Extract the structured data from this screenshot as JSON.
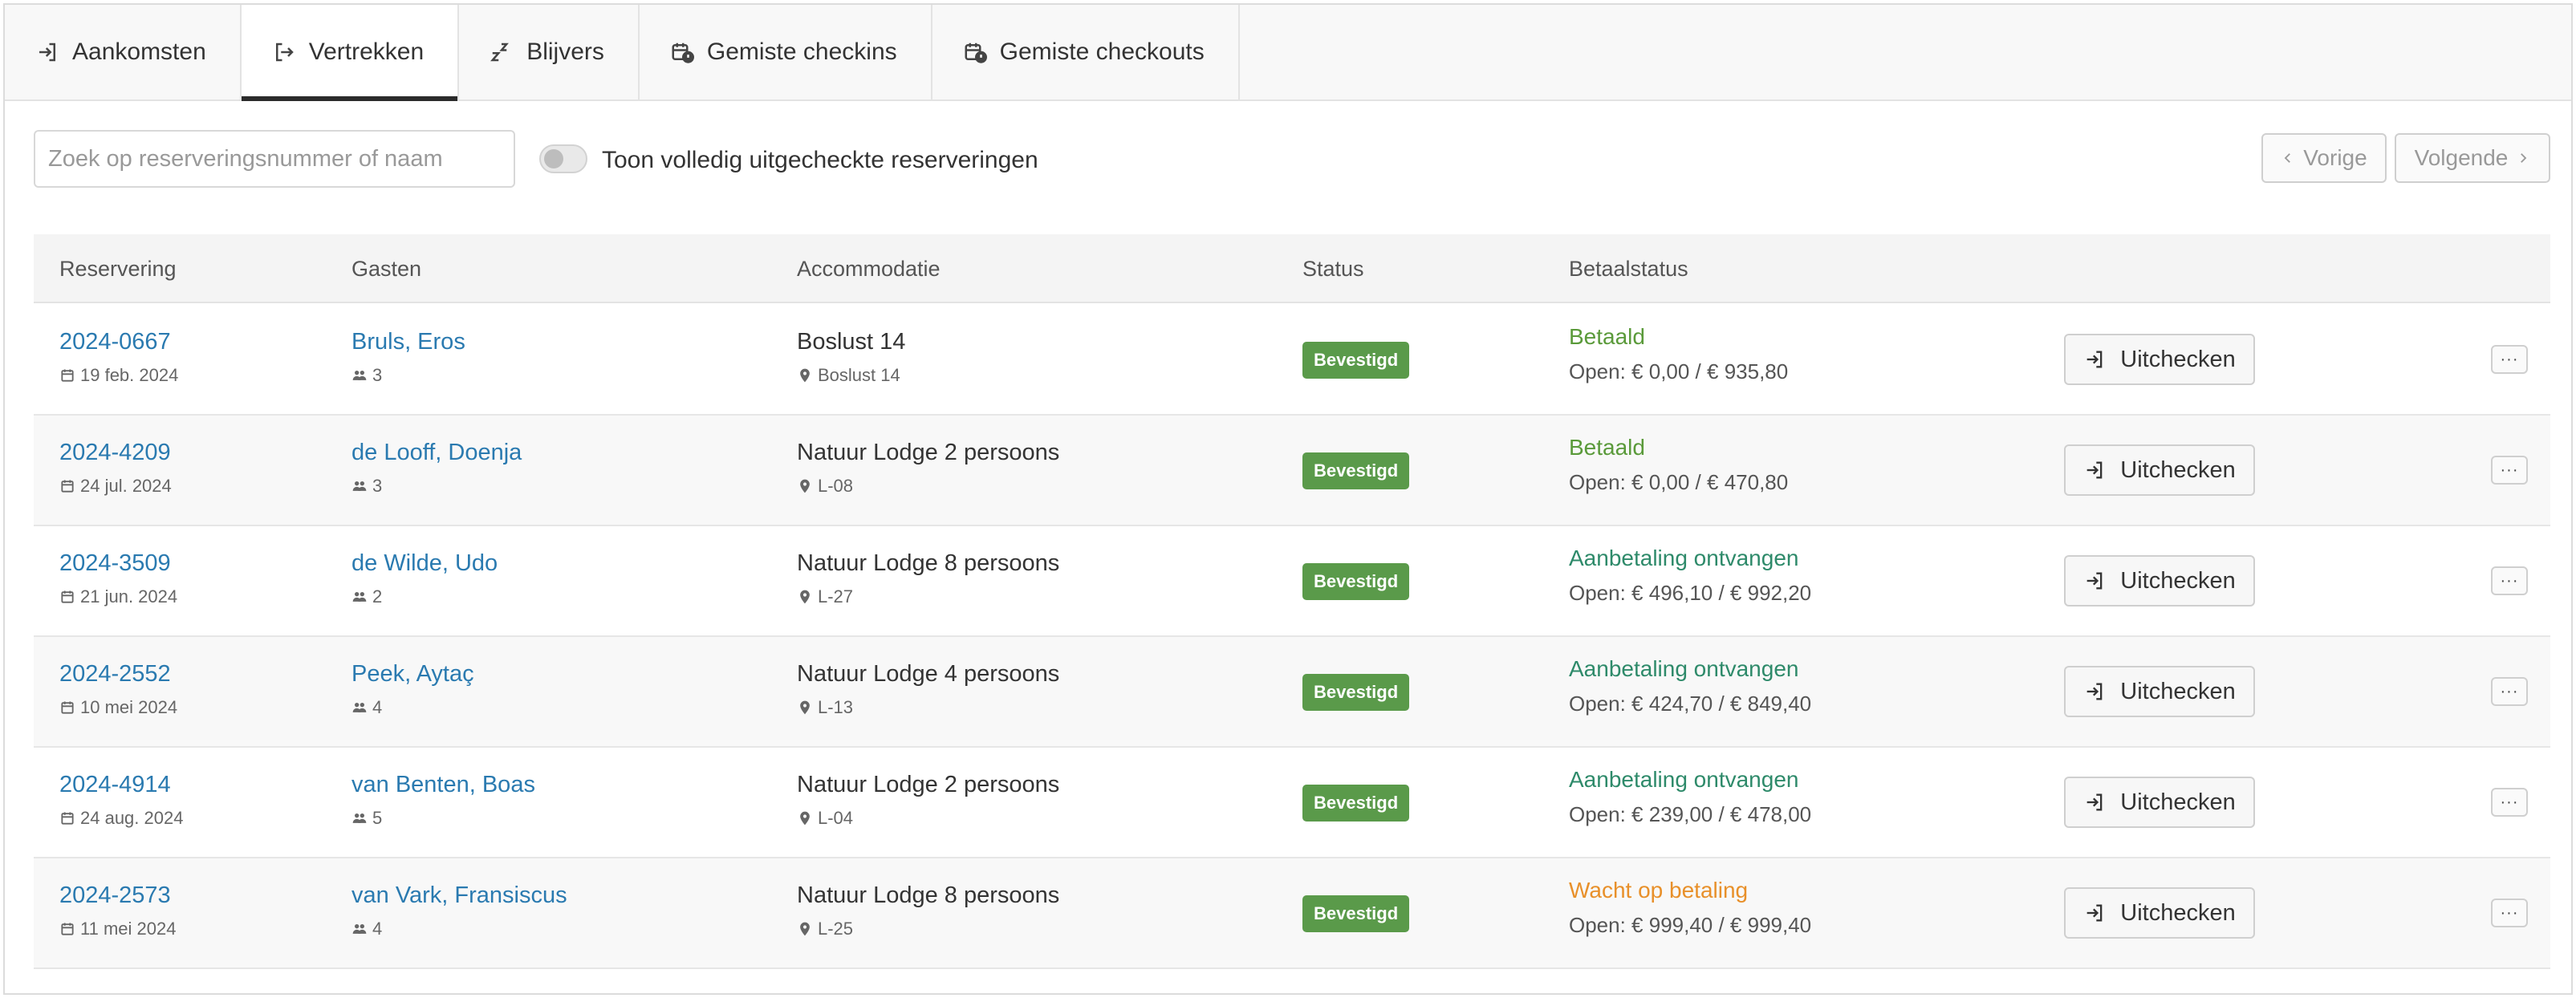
{
  "tabs": [
    {
      "label": "Aankomsten",
      "icon": "sign-in-icon",
      "active": false
    },
    {
      "label": "Vertrekken",
      "icon": "sign-out-icon",
      "active": true
    },
    {
      "label": "Blijvers",
      "icon": "sleep-zzz-icon",
      "active": false
    },
    {
      "label": "Gemiste checkins",
      "icon": "calendar-alert-icon",
      "active": false
    },
    {
      "label": "Gemiste checkouts",
      "icon": "calendar-alert-icon",
      "active": false
    }
  ],
  "search": {
    "placeholder": "Zoek op reserveringsnummer of naam",
    "value": ""
  },
  "toggle": {
    "label": "Toon volledig uitgecheckte reserveringen",
    "on": false
  },
  "pager": {
    "prev_label": "Vorige",
    "next_label": "Volgende"
  },
  "table": {
    "headers": [
      "Reservering",
      "Gasten",
      "Accommodatie",
      "Status",
      "Betaalstatus"
    ],
    "rows": [
      {
        "number": "2024-0667",
        "date": "19 feb. 2024",
        "guest": "Bruls, Eros",
        "guests": "3",
        "accommodation": "Boslust 14",
        "location": "Boslust 14",
        "status": "Bevestigd",
        "pay_status": "Betaald",
        "pay_color": "#5a9a3a",
        "open": "Open: € 0,00 / € 935,80",
        "action": "Uitchecken",
        "more": "···"
      },
      {
        "number": "2024-4209",
        "date": "24 jul. 2024",
        "guest": "de Looff, Doenja",
        "guests": "3",
        "accommodation": "Natuur Lodge 2 persoons",
        "location": "L-08",
        "status": "Bevestigd",
        "pay_status": "Betaald",
        "pay_color": "#5a9a3a",
        "open": "Open: € 0,00 / € 470,80",
        "action": "Uitchecken",
        "more": "···"
      },
      {
        "number": "2024-3509",
        "date": "21 jun. 2024",
        "guest": "de Wilde, Udo",
        "guests": "2",
        "accommodation": "Natuur Lodge 8 persoons",
        "location": "L-27",
        "status": "Bevestigd",
        "pay_status": "Aanbetaling ontvangen",
        "pay_color": "#2e8a6a",
        "open": "Open: € 496,10 / € 992,20",
        "action": "Uitchecken",
        "more": "···"
      },
      {
        "number": "2024-2552",
        "date": "10 mei 2024",
        "guest": "Peek, Aytaç",
        "guests": "4",
        "accommodation": "Natuur Lodge 4 persoons",
        "location": "L-13",
        "status": "Bevestigd",
        "pay_status": "Aanbetaling ontvangen",
        "pay_color": "#2e8a6a",
        "open": "Open: € 424,70 / € 849,40",
        "action": "Uitchecken",
        "more": "···"
      },
      {
        "number": "2024-4914",
        "date": "24 aug. 2024",
        "guest": "van Benten, Boas",
        "guests": "5",
        "accommodation": "Natuur Lodge 2 persoons",
        "location": "L-04",
        "status": "Bevestigd",
        "pay_status": "Aanbetaling ontvangen",
        "pay_color": "#2e8a6a",
        "open": "Open: € 239,00 / € 478,00",
        "action": "Uitchecken",
        "more": "···"
      },
      {
        "number": "2024-2573",
        "date": "11 mei 2024",
        "guest": "van Vark, Fransiscus",
        "guests": "4",
        "accommodation": "Natuur Lodge 8 persoons",
        "location": "L-25",
        "status": "Bevestigd",
        "pay_status": "Wacht op betaling",
        "pay_color": "#e8902a",
        "open": "Open: € 999,40 / € 999,40",
        "action": "Uitchecken",
        "more": "···"
      }
    ]
  }
}
